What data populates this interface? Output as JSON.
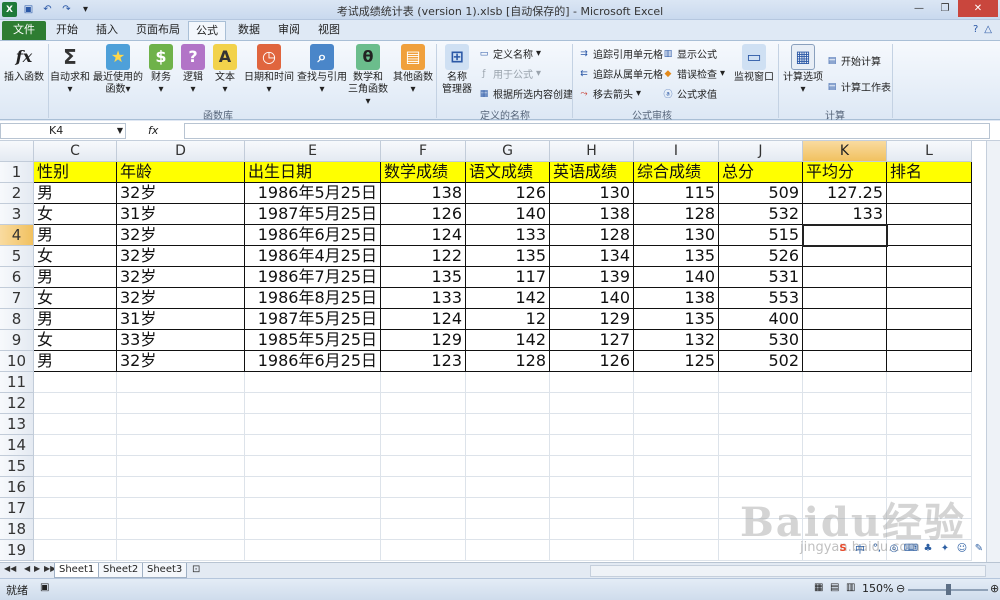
{
  "window": {
    "title": "考试成绩统计表 (version 1).xlsb [自动保存的] - Microsoft Excel"
  },
  "qat": {
    "icons": [
      "excel-icon",
      "save-icon",
      "undo-icon",
      "redo-icon"
    ]
  },
  "tabs": {
    "file": "文件",
    "items": [
      "开始",
      "插入",
      "页面布局",
      "公式",
      "数据",
      "审阅",
      "视图"
    ],
    "active": "公式"
  },
  "ribbon": {
    "insert_function": "插入函数",
    "autosum": "自动求和",
    "recent": "最近使用的",
    "recent2": "函数",
    "financial": "财务",
    "logical": "逻辑",
    "text": "文本",
    "datetime": "日期和时间",
    "lookup": "查找与引用",
    "math": "数学和",
    "math2": "三角函数",
    "more": "其他函数",
    "group_library": "函数库",
    "name_manager": "名称",
    "name_manager2": "管理器",
    "define_name": "定义名称",
    "use_in_formula": "用于公式",
    "create_from_selection": "根据所选内容创建",
    "group_names": "定义的名称",
    "trace_precedents": "追踪引用单元格",
    "trace_dependents": "追踪从属单元格",
    "remove_arrows": "移去箭头",
    "show_formulas": "显示公式",
    "error_checking": "错误检查",
    "evaluate_formula": "公式求值",
    "group_auditing": "公式审核",
    "watch_window": "监视窗口",
    "calc_options": "计算选项",
    "calc_now": "开始计算",
    "calc_sheet": "计算工作表",
    "group_calc": "计算"
  },
  "formula_bar": {
    "name_box": "K4",
    "fx": "fx",
    "value": ""
  },
  "columns": [
    "C",
    "D",
    "E",
    "F",
    "G",
    "H",
    "I",
    "J",
    "K",
    "L"
  ],
  "active_col": "K",
  "active_row": 4,
  "row_numbers": [
    "1",
    "2",
    "3",
    "4",
    "5",
    "6",
    "7",
    "8",
    "9",
    "10",
    "11",
    "12",
    "13",
    "14",
    "15",
    "16",
    "17",
    "18",
    "19"
  ],
  "table": {
    "headers": [
      "性别",
      "年龄",
      "出生日期",
      "数学成绩",
      "语文成绩",
      "英语成绩",
      "综合成绩",
      "总分",
      "平均分",
      "排名"
    ],
    "rows": [
      [
        "男",
        "32岁",
        "1986年5月25日",
        "138",
        "126",
        "130",
        "115",
        "509",
        "127.25",
        ""
      ],
      [
        "女",
        "31岁",
        "1987年5月25日",
        "126",
        "140",
        "138",
        "128",
        "532",
        "133",
        ""
      ],
      [
        "男",
        "32岁",
        "1986年6月25日",
        "124",
        "133",
        "128",
        "130",
        "515",
        "",
        ""
      ],
      [
        "女",
        "32岁",
        "1986年4月25日",
        "122",
        "135",
        "134",
        "135",
        "526",
        "",
        ""
      ],
      [
        "男",
        "32岁",
        "1986年7月25日",
        "135",
        "117",
        "139",
        "140",
        "531",
        "",
        ""
      ],
      [
        "女",
        "32岁",
        "1986年8月25日",
        "133",
        "142",
        "140",
        "138",
        "553",
        "",
        ""
      ],
      [
        "男",
        "31岁",
        "1987年5月25日",
        "124",
        "12",
        "129",
        "135",
        "400",
        "",
        ""
      ],
      [
        "女",
        "33岁",
        "1985年5月25日",
        "129",
        "142",
        "127",
        "132",
        "530",
        "",
        ""
      ],
      [
        "男",
        "32岁",
        "1986年6月25日",
        "123",
        "128",
        "126",
        "125",
        "502",
        "",
        ""
      ]
    ]
  },
  "sheets": [
    "Sheet1",
    "Sheet2",
    "Sheet3"
  ],
  "status": {
    "ready": "就绪",
    "zoom": "150%"
  },
  "watermark": {
    "text": "Baidu经验",
    "url": "jingyan.baidu.com"
  }
}
